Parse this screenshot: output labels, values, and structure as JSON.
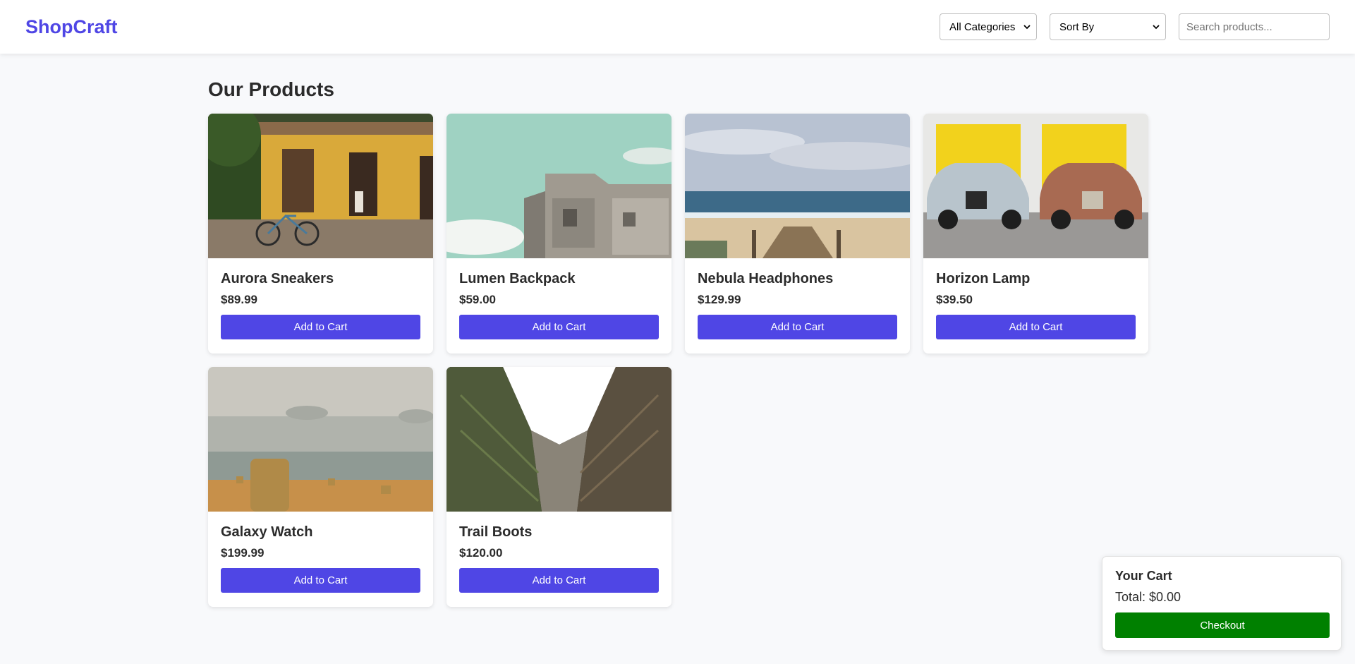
{
  "header": {
    "logo": "ShopCraft",
    "category_select": "All Categories",
    "sort_select": "Sort By",
    "search_placeholder": "Search products..."
  },
  "main": {
    "title": "Our Products",
    "products": [
      {
        "name": "Aurora Sneakers",
        "price": "$89.99",
        "button": "Add to Cart",
        "image": "yellow-house-bicycle-photo"
      },
      {
        "name": "Lumen Backpack",
        "price": "$59.00",
        "button": "Add to Cart",
        "image": "concrete-bunker-sky-photo"
      },
      {
        "name": "Nebula Headphones",
        "price": "$129.99",
        "button": "Add to Cart",
        "image": "beach-shore-photo"
      },
      {
        "name": "Horizon Lamp",
        "price": "$39.50",
        "button": "Add to Cart",
        "image": "vintage-cars-yellow-doors-photo"
      },
      {
        "name": "Galaxy Watch",
        "price": "$199.99",
        "button": "Add to Cart",
        "image": "hay-bale-misty-field-photo"
      },
      {
        "name": "Trail Boots",
        "price": "$120.00",
        "button": "Add to Cart",
        "image": "building-courtyard-sky-photo"
      }
    ]
  },
  "cart": {
    "title": "Your Cart",
    "total": "Total: $0.00",
    "checkout": "Checkout"
  },
  "colors": {
    "brand": "#4f46e5",
    "checkout": "#008000",
    "background": "#f8f9fb"
  }
}
